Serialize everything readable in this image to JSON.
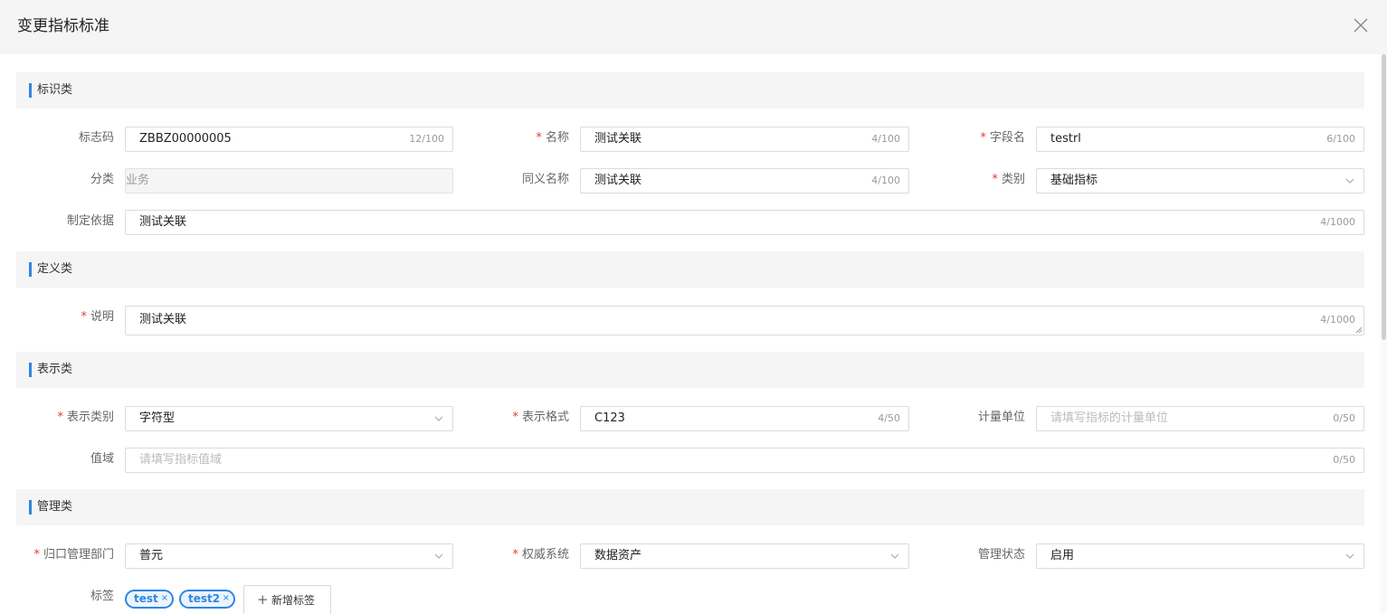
{
  "dialog": {
    "title": "变更指标标准"
  },
  "sections": {
    "identification": "标识类",
    "definition": "定义类",
    "representation": "表示类",
    "management": "管理类"
  },
  "fields": {
    "code": {
      "label": "标志码",
      "value": "ZBBZ00000005",
      "count": "12/100"
    },
    "name": {
      "label": "名称",
      "value": "测试关联",
      "count": "4/100"
    },
    "field_name": {
      "label": "字段名",
      "value": "testrl",
      "count": "6/100"
    },
    "category": {
      "label": "分类",
      "value": "业务"
    },
    "synonym": {
      "label": "同义名称",
      "value": "测试关联",
      "count": "4/100"
    },
    "type": {
      "label": "类别",
      "value": "基础指标"
    },
    "basis": {
      "label": "制定依据",
      "value": "测试关联",
      "count": "4/1000"
    },
    "description": {
      "label": "说明",
      "value": "测试关联",
      "count": "4/1000"
    },
    "rep_type": {
      "label": "表示类别",
      "value": "字符型"
    },
    "rep_format": {
      "label": "表示格式",
      "value": "C123",
      "count": "4/50"
    },
    "unit": {
      "label": "计量单位",
      "placeholder": "请填写指标的计量单位",
      "count": "0/50"
    },
    "domain": {
      "label": "值域",
      "placeholder": "请填写指标值域",
      "count": "0/50"
    },
    "dept": {
      "label": "归口管理部门",
      "value": "普元"
    },
    "system": {
      "label": "权威系统",
      "value": "数据资产"
    },
    "status": {
      "label": "管理状态",
      "value": "启用"
    },
    "tags": {
      "label": "标签",
      "items": [
        "test",
        "test2"
      ],
      "add_label": "新增标签"
    }
  },
  "icons": {
    "close": "close-icon",
    "dropdown": "chevron-down-icon",
    "tag_remove": "×",
    "add": "+"
  },
  "colors": {
    "accent": "#2f86e0",
    "required": "#e4393c",
    "section_bg": "#f5f5f5"
  }
}
